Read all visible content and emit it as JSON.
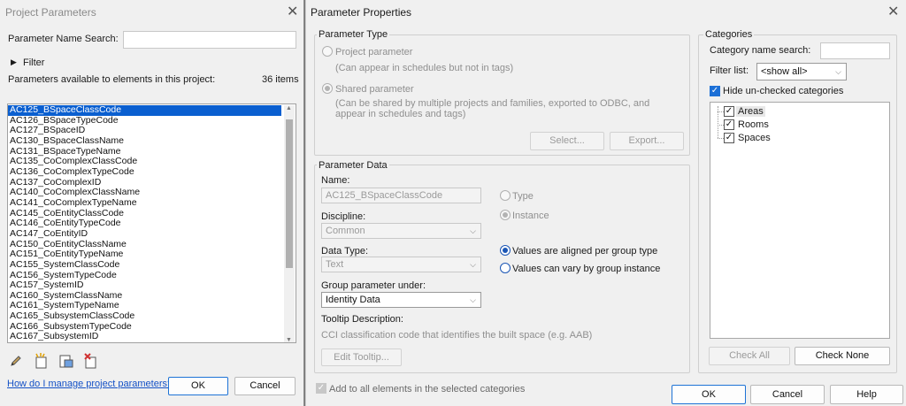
{
  "left_dialog": {
    "title": "Project Parameters",
    "search_label": "Parameter Name Search:",
    "search_value": "",
    "filter_label": "Filter",
    "available_label": "Parameters available to elements in this project:",
    "count": "36 items",
    "parameters": [
      "AC125_BSpaceClassCode",
      "AC126_BSpaceTypeCode",
      "AC127_BSpaceID",
      "AC130_BSpaceClassName",
      "AC131_BSpaceTypeName",
      "AC135_CoComplexClassCode",
      "AC136_CoComplexTypeCode",
      "AC137_CoComplexID",
      "AC140_CoComplexClassName",
      "AC141_CoComplexTypeName",
      "AC145_CoEntityClassCode",
      "AC146_CoEntityTypeCode",
      "AC147_CoEntityID",
      "AC150_CoEntityClassName",
      "AC151_CoEntityTypeName",
      "AC155_SystemClassCode",
      "AC156_SystemTypeCode",
      "AC157_SystemID",
      "AC160_SystemClassName",
      "AC161_SystemTypeName",
      "AC165_SubsystemClassCode",
      "AC166_SubsystemTypeCode",
      "AC167_SubsystemID"
    ],
    "selected_index": 0,
    "help_link": "How do I manage project parameters?",
    "ok": "OK",
    "cancel": "Cancel"
  },
  "right_dialog": {
    "title": "Parameter Properties",
    "parameter_type": {
      "group_title": "Parameter Type",
      "project_param": "Project parameter",
      "project_desc": "(Can appear in schedules but not in tags)",
      "shared_param": "Shared parameter",
      "shared_desc_1": "(Can be shared by multiple projects and families, exported to ODBC, and",
      "shared_desc_2": "appear in schedules and tags)",
      "select_btn": "Select...",
      "export_btn": "Export..."
    },
    "parameter_data": {
      "group_title": "Parameter Data",
      "name_label": "Name:",
      "name_value": "AC125_BSpaceClassCode",
      "type_radio": "Type",
      "instance_radio": "Instance",
      "discipline_label": "Discipline:",
      "discipline_value": "Common",
      "data_type_label": "Data Type:",
      "data_type_value": "Text",
      "aligned_radio": "Values are aligned per group type",
      "vary_radio": "Values can vary by group instance",
      "group_under_label": "Group parameter under:",
      "group_under_value": "Identity Data",
      "tooltip_label": "Tooltip Description:",
      "tooltip_value": "CCI classification code that identifies the built space (e.g. AAB)",
      "edit_tooltip_btn": "Edit Tooltip..."
    },
    "categories": {
      "group_title": "Categories",
      "search_label": "Category name search:",
      "filter_label": "Filter list:",
      "filter_value": "<show all>",
      "hide_label": "Hide un-checked categories",
      "items": [
        "Areas",
        "Rooms",
        "Spaces"
      ],
      "check_all": "Check All",
      "check_none": "Check None"
    },
    "add_all_label": "Add to all elements in the selected categories",
    "ok": "OK",
    "cancel": "Cancel",
    "help": "Help"
  }
}
